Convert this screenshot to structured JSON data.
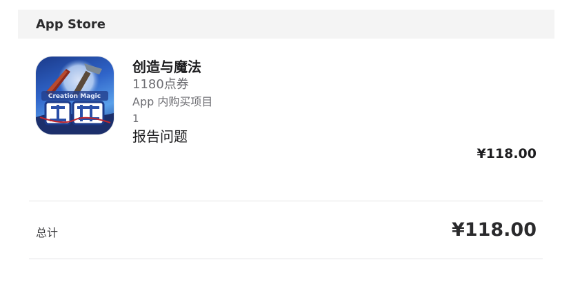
{
  "section": {
    "title": "App Store"
  },
  "item": {
    "icon": "app-game-icon",
    "icon_art_text": "Creation Magic",
    "name": "创造与魔法",
    "amount": "1180点券",
    "purchase_type": "App 内购买项目",
    "quantity": "1",
    "report_link": "报告问题",
    "price": "¥118.00"
  },
  "total": {
    "label": "总计",
    "value": "¥118.00"
  }
}
